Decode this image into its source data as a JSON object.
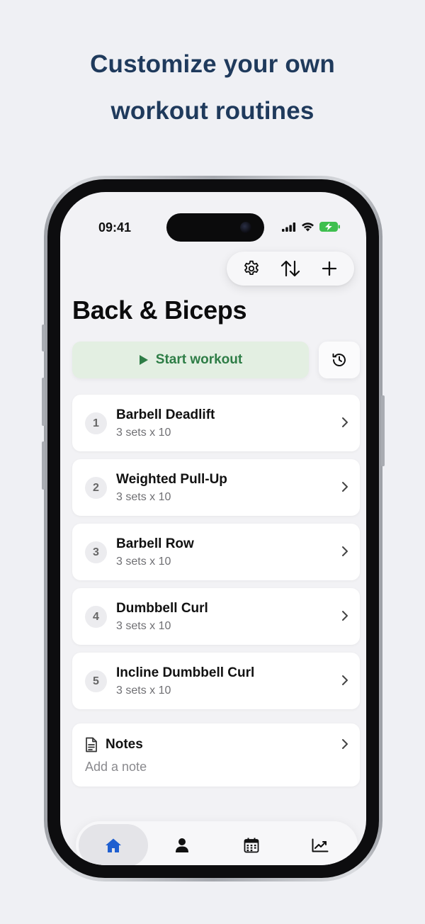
{
  "headline": {
    "line1": "Customize your own",
    "line2": "workout routines"
  },
  "status_bar": {
    "time": "09:41",
    "icons": [
      "signal-icon",
      "wifi-icon",
      "battery-charging-icon"
    ]
  },
  "toolbar": {
    "icons": [
      "gear-icon",
      "sort-icon",
      "plus-icon"
    ]
  },
  "routine": {
    "title": "Back & Biceps"
  },
  "start_button": {
    "label": "Start workout",
    "icon": "play-icon"
  },
  "history_button": {
    "icon": "history-icon"
  },
  "exercises": [
    {
      "number": "1",
      "name": "Barbell Deadlift",
      "sets": "3 sets x 10"
    },
    {
      "number": "2",
      "name": "Weighted Pull-Up",
      "sets": "3 sets x 10"
    },
    {
      "number": "3",
      "name": "Barbell Row",
      "sets": "3 sets x 10"
    },
    {
      "number": "4",
      "name": "Dumbbell Curl",
      "sets": "3 sets x 10"
    },
    {
      "number": "5",
      "name": "Incline Dumbbell Curl",
      "sets": "3 sets x 10"
    }
  ],
  "notes": {
    "title": "Notes",
    "placeholder": "Add a note"
  },
  "tabbar": {
    "tabs": [
      "home-icon",
      "profile-icon",
      "calendar-icon",
      "stats-icon"
    ],
    "active": "home-icon"
  },
  "colors": {
    "headline": "#1f3a5c",
    "accent_green": "#2e7d46",
    "start_bg": "#e3efe2",
    "active_tab": "#1f5fd0"
  }
}
